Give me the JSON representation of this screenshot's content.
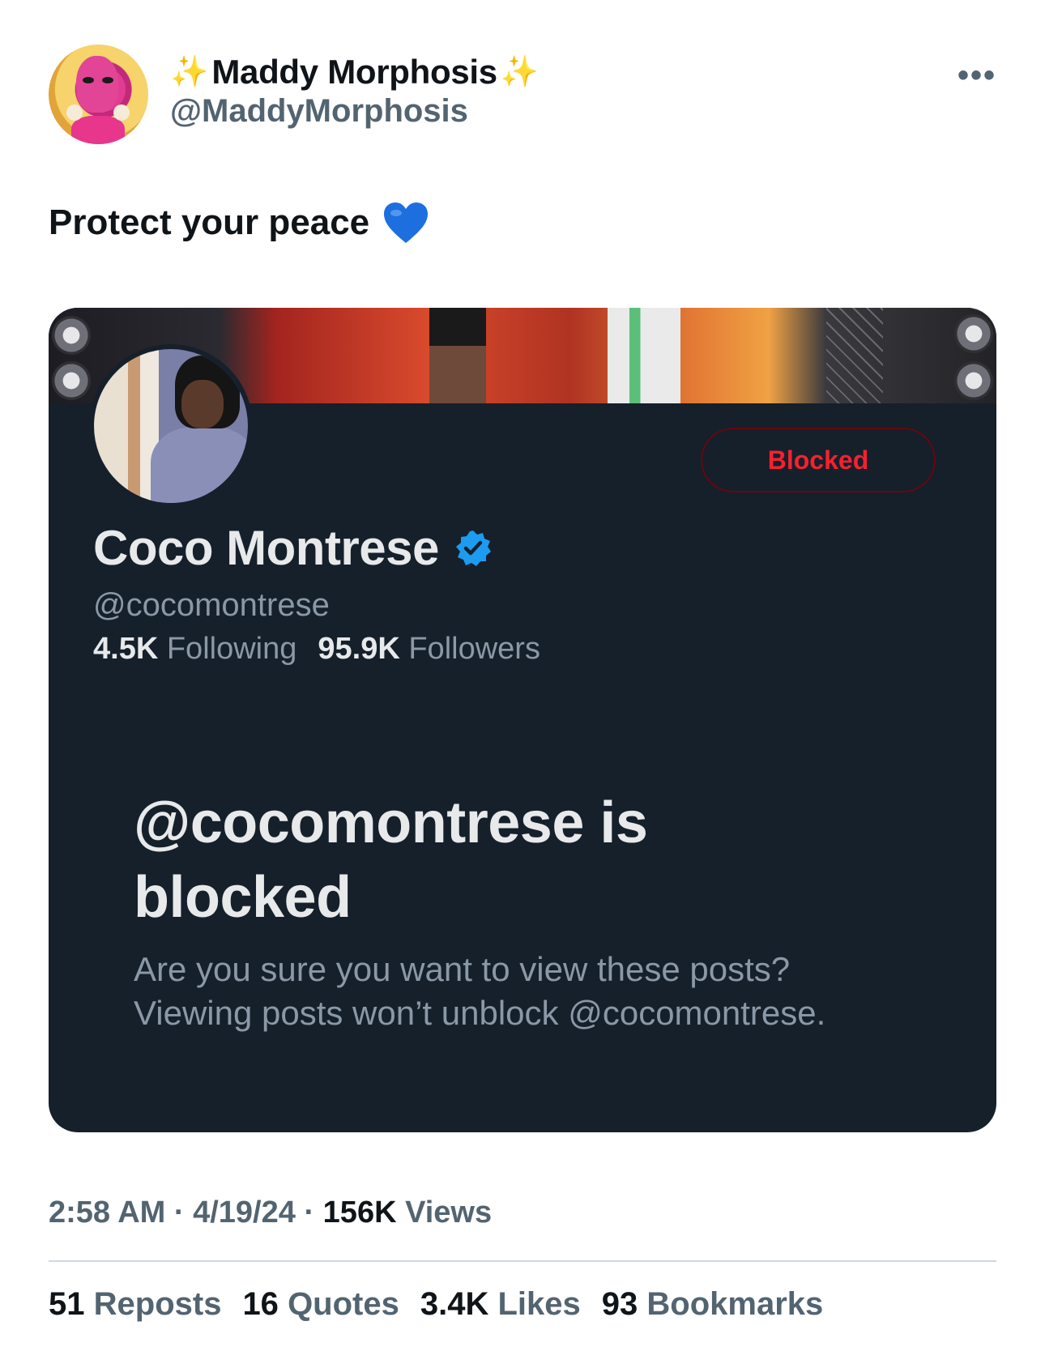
{
  "author": {
    "sparkle_left": "✨",
    "display_name": "Maddy Morphosis",
    "sparkle_right": "✨",
    "handle": "@MaddyMorphosis"
  },
  "more_label": "•••",
  "tweet": {
    "text": "Protect your peace",
    "emoji": "blue-heart-icon"
  },
  "embedded_profile": {
    "blocked_button": "Blocked",
    "name": "Coco Montrese",
    "handle": "@cocomontrese",
    "following_count": "4.5K",
    "following_label": "Following",
    "followers_count": "95.9K",
    "followers_label": "Followers",
    "blocked_title": "@cocomontrese is blocked",
    "blocked_desc": "Are you sure you want to view these posts? Viewing posts won’t unblock @cocomontrese."
  },
  "meta": {
    "time": "2:58 AM",
    "sep1": " · ",
    "date": "4/19/24",
    "sep2": " · ",
    "views_count": "156K",
    "views_label": "Views"
  },
  "engagements": {
    "reposts_count": "51",
    "reposts_label": "Reposts",
    "quotes_count": "16",
    "quotes_label": "Quotes",
    "likes_count": "3.4K",
    "likes_label": "Likes",
    "bookmarks_count": "93",
    "bookmarks_label": "Bookmarks"
  },
  "colors": {
    "accent_blue": "#1d9bf0",
    "blocked_red": "#f4212e",
    "card_bg": "#15202b",
    "heart_blue": "#1d6fe0"
  }
}
